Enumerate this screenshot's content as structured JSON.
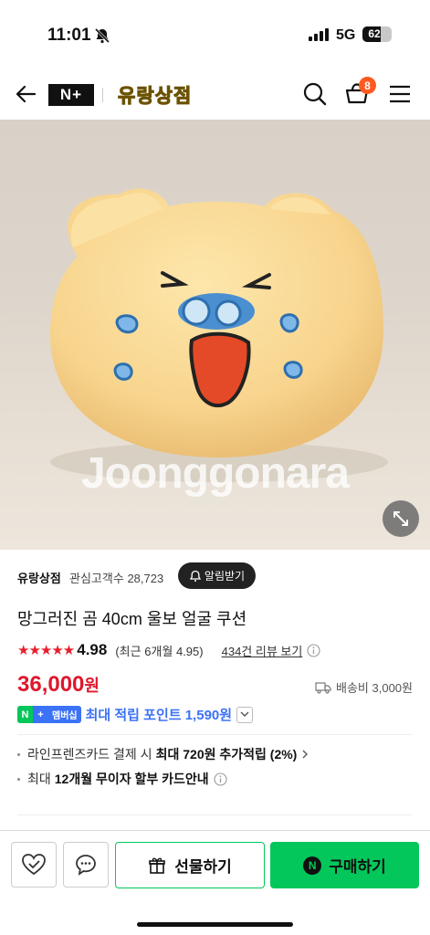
{
  "status": {
    "time": "11:01",
    "network": "5G",
    "battery": "62",
    "battery_level": 0.62
  },
  "nav": {
    "badge": "N+",
    "shop_name": "유랑상점",
    "cart_count": "8"
  },
  "product_image": {
    "watermark": "Joonggonara"
  },
  "seller": {
    "name": "유랑상점",
    "fans_label": "관심고객수",
    "fans": "28,723",
    "alarm_label": "알림받기"
  },
  "product": {
    "title": "망그러진 곰 40cm 울보 얼굴 쿠션",
    "stars": "★★★★★",
    "rating": "4.98",
    "rating_note": "(최근 6개월 4.95)",
    "reviews_link": "434건 리뷰 보기",
    "price": "36,000",
    "price_unit": "원",
    "shipping": "배송비 3,000원"
  },
  "membership": {
    "n": "N",
    "plus": "+",
    "tag": "멤버십",
    "text": "최대 적립 포인트 1,590원"
  },
  "benefits": [
    {
      "prefix": "라인프렌즈카드 결제 시",
      "bold": "최대 720원 추가적립 (2%)"
    },
    {
      "prefix": "최대",
      "bold": "12개월 무이자 할부 카드안내"
    }
  ],
  "actions": {
    "gift_label": "선물하기",
    "buy_label": "구매하기",
    "buy_icon": "N"
  },
  "colors": {
    "accent_green": "#03c75a",
    "price_red": "#e0172b",
    "member_blue": "#3b72f6"
  }
}
